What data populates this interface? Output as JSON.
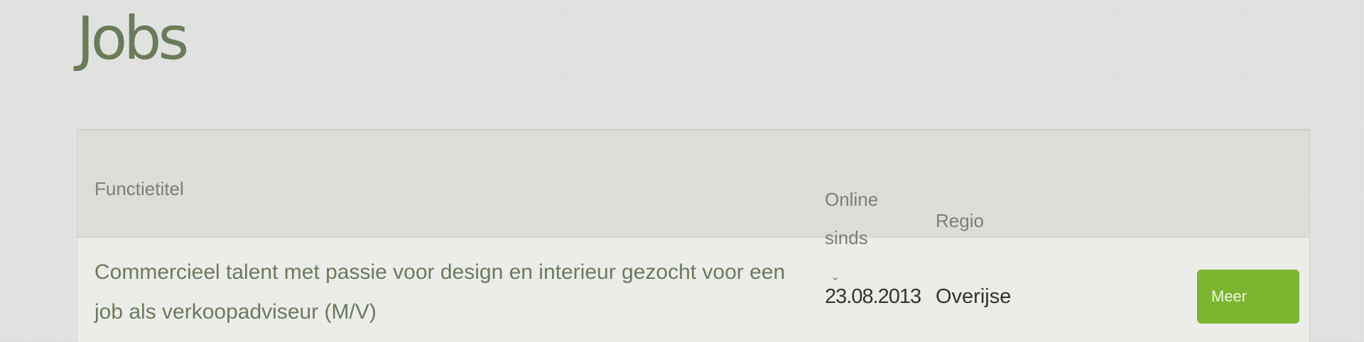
{
  "page": {
    "title": "Jobs"
  },
  "table": {
    "columns": {
      "title": "Functietitel",
      "online_since_line1": "Online",
      "online_since_line2": "sinds",
      "region": "Regio"
    },
    "sort_icon": "chevron-down-icon",
    "rows": [
      {
        "title": "Commercieel talent met passie voor design en interieur gezocht voor een job als verkoopadviseur (M/V)",
        "online_since": "23.08.2013",
        "region": "Overijse",
        "button_label": "Meer"
      }
    ]
  },
  "colors": {
    "accent": "#7cb52f",
    "title_text": "#6b7b5a"
  }
}
